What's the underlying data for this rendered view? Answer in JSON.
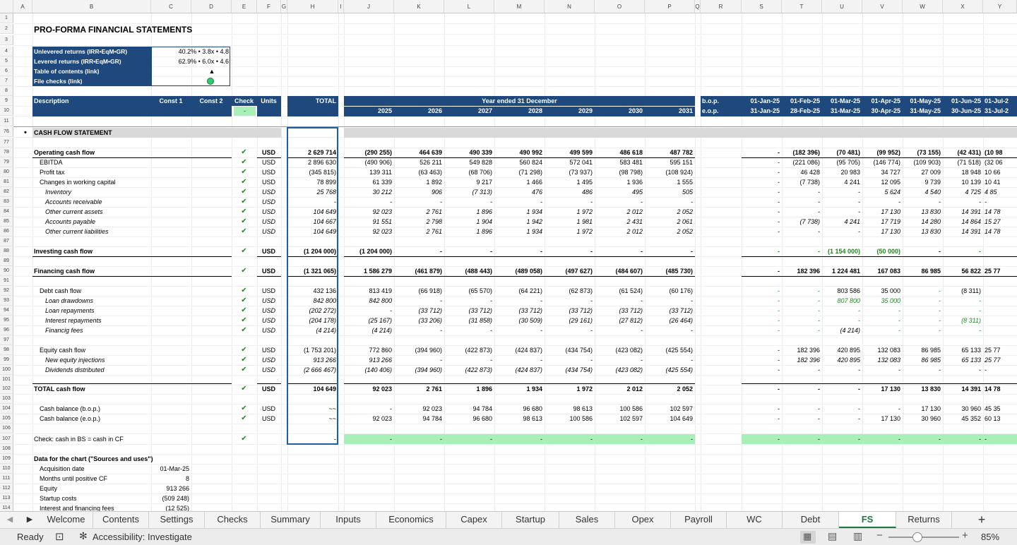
{
  "colors": {
    "header_band": "#1f497d",
    "green_fill": "#a8f0b8",
    "section_gray": "#d9d9d9",
    "check_green": "#1a8a1a",
    "active_tab": "#1e7a3c"
  },
  "col_headers": [
    "A",
    "B",
    "C",
    "D",
    "E",
    "F",
    "G",
    "H",
    "I",
    "J",
    "K",
    "L",
    "M",
    "N",
    "O",
    "P",
    "Q",
    "R",
    "S",
    "T",
    "U",
    "V",
    "W",
    "X",
    "Y"
  ],
  "title": "PRO-FORMA FINANCIAL STATEMENTS",
  "info_box": [
    {
      "label": "Unlevered returns (IRR•EqM•GR)",
      "value": "40.2% • 3.8x • 4.8"
    },
    {
      "label": "Levered returns (IRR•EqM•GR)",
      "value": "62.9% • 6.0x • 4.6"
    },
    {
      "label": "Table of contents (link)",
      "value": "▲"
    },
    {
      "label": "File checks (link)",
      "value": ""
    }
  ],
  "header": {
    "description": "Description",
    "const1": "Const 1",
    "const2": "Const 2",
    "check": "Check",
    "check_value": "-",
    "units": "Units",
    "total": "TOTAL",
    "year_ended": "Year ended 31 December",
    "years": [
      "2025",
      "2026",
      "2027",
      "2028",
      "2029",
      "2030",
      "2031"
    ],
    "bop": "b.o.p.",
    "eop": "e.o.p.",
    "months_bop": [
      "01-Jan-25",
      "01-Feb-25",
      "01-Mar-25",
      "01-Apr-25",
      "01-May-25",
      "01-Jun-25",
      "01-Jul-2"
    ],
    "months_eop": [
      "31-Jan-25",
      "28-Feb-25",
      "31-Mar-25",
      "30-Apr-25",
      "31-May-25",
      "30-Jun-25",
      "31-Jul-2"
    ]
  },
  "section": {
    "bullet": "•",
    "label": "CASH FLOW STATEMENT"
  },
  "rows": [
    {
      "n": "78",
      "label": "Operating cash flow",
      "indent": 0,
      "style": "b",
      "units": "USD",
      "check": true,
      "total": "2 629 714",
      "years": [
        "(290 255)",
        "464 639",
        "490 339",
        "490 992",
        "499 599",
        "486 618",
        "487 782"
      ],
      "r": "-",
      "months": [
        "(182 396)",
        "(70 481)",
        "(99 952)",
        "(73 155)",
        "(42 431)",
        "(10 98"
      ]
    },
    {
      "n": "79",
      "label": "EBITDA",
      "indent": 1,
      "units": "USD",
      "check": true,
      "total": "2 896 630",
      "years": [
        "(490 906)",
        "526 211",
        "549 828",
        "560 824",
        "572 041",
        "583 481",
        "595 151"
      ],
      "r": "-",
      "months": [
        "(221 086)",
        "(95 705)",
        "(146 774)",
        "(109 903)",
        "(71 518)",
        "(32 06"
      ]
    },
    {
      "n": "80",
      "label": "Profit tax",
      "indent": 1,
      "units": "USD",
      "check": true,
      "total": "(345 815)",
      "years": [
        "139 311",
        "(63 463)",
        "(68 706)",
        "(71 298)",
        "(73 937)",
        "(98 798)",
        "(108 924)"
      ],
      "r": "-",
      "months": [
        "46 428",
        "20 983",
        "34 727",
        "27 009",
        "18 948",
        "10 66"
      ]
    },
    {
      "n": "81",
      "label": "Changes in working capital",
      "indent": 1,
      "units": "USD",
      "check": true,
      "total": "78 899",
      "years": [
        "61 339",
        "1 892",
        "9 217",
        "1 466",
        "1 495",
        "1 936",
        "1 555"
      ],
      "r": "-",
      "months": [
        "(7 738)",
        "4 241",
        "12 095",
        "9 739",
        "10 139",
        "10 41"
      ]
    },
    {
      "n": "82",
      "label": "Inventory",
      "indent": 2,
      "style": "i",
      "units": "USD",
      "check": true,
      "total": "25 768",
      "years": [
        "30 212",
        "906",
        "(7 313)",
        "476",
        "486",
        "495",
        "505"
      ],
      "r": "-",
      "months": [
        "-",
        "-",
        "5 624",
        "4 540",
        "4 725",
        "4 85"
      ]
    },
    {
      "n": "83",
      "label": "Accounts receivable",
      "indent": 2,
      "style": "i",
      "units": "USD",
      "check": true,
      "total": "-",
      "years": [
        "-",
        "-",
        "-",
        "-",
        "-",
        "-",
        "-"
      ],
      "r": "-",
      "months": [
        "-",
        "-",
        "-",
        "-",
        "-",
        "-"
      ]
    },
    {
      "n": "84",
      "label": "Other current assets",
      "indent": 2,
      "style": "i",
      "units": "USD",
      "check": true,
      "total": "104 649",
      "years": [
        "92 023",
        "2 761",
        "1 896",
        "1 934",
        "1 972",
        "2 012",
        "2 052"
      ],
      "r": "-",
      "months": [
        "-",
        "-",
        "17 130",
        "13 830",
        "14 391",
        "14 78"
      ]
    },
    {
      "n": "85",
      "label": "Accounts payable",
      "indent": 2,
      "style": "i",
      "units": "USD",
      "check": true,
      "total": "104 667",
      "years": [
        "91 551",
        "2 798",
        "1 904",
        "1 942",
        "1 981",
        "2 431",
        "2 061"
      ],
      "r": "-",
      "months": [
        "(7 738)",
        "4 241",
        "17 719",
        "14 280",
        "14 864",
        "15 27"
      ]
    },
    {
      "n": "86",
      "label": "Other current liabilities",
      "indent": 2,
      "style": "i",
      "units": "USD",
      "check": true,
      "total": "104 649",
      "years": [
        "92 023",
        "2 761",
        "1 896",
        "1 934",
        "1 972",
        "2 012",
        "2 052"
      ],
      "r": "-",
      "months": [
        "-",
        "-",
        "17 130",
        "13 830",
        "14 391",
        "14 78"
      ]
    },
    {
      "n": "87",
      "blank": true
    },
    {
      "n": "88",
      "label": "Investing cash flow",
      "indent": 0,
      "style": "b",
      "units": "USD",
      "check": true,
      "total": "(1 204 000)",
      "years": [
        "(1 204 000)",
        "-",
        "-",
        "-",
        "-",
        "-",
        "-"
      ],
      "r": "-",
      "rg": true,
      "months": [
        "-",
        "(1 154 000)",
        "(50 000)",
        "-",
        "-",
        ""
      ],
      "mg": [
        1,
        1,
        1,
        0,
        1,
        0
      ],
      "ul": true
    },
    {
      "n": "89",
      "blank": true
    },
    {
      "n": "90",
      "label": "Financing cash flow",
      "indent": 0,
      "style": "b",
      "units": "USD",
      "check": true,
      "total": "(1 321 065)",
      "years": [
        "1 586 279",
        "(461 879)",
        "(488 443)",
        "(489 058)",
        "(497 627)",
        "(484 607)",
        "(485 730)"
      ],
      "r": "-",
      "months": [
        "182 396",
        "1 224 481",
        "167 083",
        "86 985",
        "56 822",
        "25 77"
      ],
      "ul": true
    },
    {
      "n": "91",
      "blank": true
    },
    {
      "n": "92",
      "label": "Debt cash flow",
      "indent": 1,
      "units": "USD",
      "check": true,
      "total": "432 136",
      "years": [
        "813 419",
        "(66 918)",
        "(65 570)",
        "(64 221)",
        "(62 873)",
        "(61 524)",
        "(60 176)"
      ],
      "r": "-",
      "rg": true,
      "months": [
        "-",
        "803 586",
        "35 000",
        "-",
        "(8 311)",
        ""
      ],
      "mg": [
        1,
        0,
        0,
        1,
        0,
        0
      ]
    },
    {
      "n": "93",
      "label": "Loan drawdowns",
      "indent": 2,
      "style": "i",
      "units": "USD",
      "check": true,
      "total": "842 800",
      "years": [
        "842 800",
        "-",
        "-",
        "-",
        "-",
        "-",
        "-"
      ],
      "r": "-",
      "rg": true,
      "months": [
        "-",
        "807 800",
        "35 000",
        "-",
        "-",
        ""
      ],
      "mg": [
        1,
        1,
        1,
        1,
        1,
        0
      ]
    },
    {
      "n": "94",
      "label": "Loan repayments",
      "indent": 2,
      "style": "i",
      "units": "USD",
      "check": true,
      "total": "(202 272)",
      "years": [
        "-",
        "(33 712)",
        "(33 712)",
        "(33 712)",
        "(33 712)",
        "(33 712)",
        "(33 712)"
      ],
      "r": "-",
      "rg": true,
      "months": [
        "-",
        "-",
        "-",
        "-",
        "-",
        ""
      ],
      "mg": [
        1,
        1,
        1,
        1,
        1,
        0
      ]
    },
    {
      "n": "95",
      "label": "Interest repayments",
      "indent": 2,
      "style": "i",
      "units": "USD",
      "check": true,
      "total": "(204 178)",
      "years": [
        "(25 167)",
        "(33 206)",
        "(31 858)",
        "(30 509)",
        "(29 161)",
        "(27 812)",
        "(26 464)"
      ],
      "r": "-",
      "rg": true,
      "months": [
        "-",
        "-",
        "-",
        "-",
        "(8 311)",
        ""
      ],
      "mg": [
        1,
        1,
        1,
        1,
        1,
        0
      ]
    },
    {
      "n": "96",
      "label": "Financig fees",
      "indent": 2,
      "style": "i",
      "units": "USD",
      "check": true,
      "total": "(4 214)",
      "years": [
        "(4 214)",
        "-",
        "-",
        "-",
        "-",
        "-",
        "-"
      ],
      "r": "-",
      "rg": true,
      "months": [
        "-",
        "(4 214)",
        "-",
        "-",
        "-",
        ""
      ],
      "mg": [
        1,
        0,
        1,
        1,
        1,
        0
      ]
    },
    {
      "n": "97",
      "blank": true
    },
    {
      "n": "98",
      "label": "Equity cash flow",
      "indent": 1,
      "units": "USD",
      "check": true,
      "total": "(1 753 201)",
      "years": [
        "772 860",
        "(394 960)",
        "(422 873)",
        "(424 837)",
        "(434 754)",
        "(423 082)",
        "(425 554)"
      ],
      "r": "-",
      "months": [
        "182 396",
        "420 895",
        "132 083",
        "86 985",
        "65 133",
        "25 77"
      ]
    },
    {
      "n": "99",
      "label": "New equity injections",
      "indent": 2,
      "style": "i",
      "units": "USD",
      "check": true,
      "total": "913 266",
      "years": [
        "913 266",
        "-",
        "-",
        "-",
        "-",
        "-",
        "-"
      ],
      "r": "-",
      "months": [
        "182 396",
        "420 895",
        "132 083",
        "86 985",
        "65 133",
        "25 77"
      ]
    },
    {
      "n": "100",
      "label": "Dividends distributed",
      "indent": 2,
      "style": "i",
      "units": "USD",
      "check": true,
      "total": "(2 666 467)",
      "years": [
        "(140 406)",
        "(394 960)",
        "(422 873)",
        "(424 837)",
        "(434 754)",
        "(423 082)",
        "(425 554)"
      ],
      "r": "-",
      "months": [
        "-",
        "-",
        "-",
        "-",
        "-",
        "-"
      ]
    },
    {
      "n": "101",
      "blank": true
    },
    {
      "n": "102",
      "label": "TOTAL cash flow",
      "indent": 0,
      "style": "b",
      "units": "USD",
      "check": true,
      "total": "104 649",
      "years": [
        "92 023",
        "2 761",
        "1 896",
        "1 934",
        "1 972",
        "2 012",
        "2 052"
      ],
      "r": "-",
      "months": [
        "-",
        "-",
        "17 130",
        "13 830",
        "14 391",
        "14 78"
      ],
      "ol": true
    },
    {
      "n": "103",
      "blank": true
    },
    {
      "n": "104",
      "label": "Cash balance (b.o.p.)",
      "indent": 1,
      "units": "USD",
      "check": true,
      "total": "~~",
      "years": [
        "-",
        "92 023",
        "94 784",
        "96 680",
        "98 613",
        "100 586",
        "102 597"
      ],
      "r": "-",
      "months": [
        "-",
        "-",
        "-",
        "17 130",
        "30 960",
        "45 35"
      ]
    },
    {
      "n": "105",
      "label": "Cash balance (e.o.p.)",
      "indent": 1,
      "units": "USD",
      "check": true,
      "total": "~~",
      "years": [
        "92 023",
        "94 784",
        "96 680",
        "98 613",
        "100 586",
        "102 597",
        "104 649"
      ],
      "r": "-",
      "months": [
        "-",
        "-",
        "17 130",
        "30 960",
        "45 352",
        "60 13"
      ]
    },
    {
      "n": "106",
      "blank": true
    },
    {
      "n": "107",
      "label": "Check: cash in BS = cash in CF",
      "indent": 0,
      "units": "",
      "check": true,
      "total": "-",
      "years": [
        "-",
        "-",
        "-",
        "-",
        "-",
        "-",
        "-"
      ],
      "r": "-",
      "months": [
        "-",
        "-",
        "-",
        "-",
        "-",
        "-"
      ],
      "green": true
    }
  ],
  "chart_section": {
    "title": "Data for the chart (\"Sources and uses\")",
    "items": [
      {
        "n": "110",
        "label": "Acquisition date",
        "value": "01-Mar-25"
      },
      {
        "n": "111",
        "label": "Months until positive CF",
        "value": "8"
      },
      {
        "n": "112",
        "label": "Equity",
        "value": "913 266"
      },
      {
        "n": "113",
        "label": "Startup costs",
        "value": "(509 248)"
      },
      {
        "n": "114",
        "label": "Interest and financing fees",
        "value": "(12 525)"
      }
    ]
  },
  "row_numbers": [
    "1",
    "2",
    "3",
    "4",
    "5",
    "6",
    "7",
    "8",
    "9",
    "10",
    "11"
  ],
  "tabs": [
    "Welcome",
    "Contents",
    "Settings",
    "Checks",
    "Summary",
    "Inputs",
    "Economics",
    "Capex",
    "Startup",
    "Sales",
    "Opex",
    "Payroll",
    "WC",
    "Debt",
    "FS",
    "Returns"
  ],
  "active_tab": "FS",
  "status": {
    "ready": "Ready",
    "accessibility": "Accessibility: Investigate",
    "zoom": "85%"
  }
}
